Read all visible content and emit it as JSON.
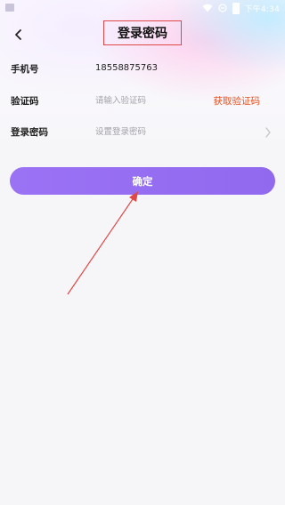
{
  "status_bar": {
    "time": "下午4:34"
  },
  "nav": {
    "back_icon": "chevron-left-icon",
    "title": "登录密码"
  },
  "form": {
    "phone": {
      "label": "手机号",
      "value": "18558875763"
    },
    "code": {
      "label": "验证码",
      "placeholder": "请输入验证码",
      "action": "获取验证码"
    },
    "password": {
      "label": "登录密码",
      "placeholder": "设置登录密码",
      "icon": "chevron-right-icon"
    }
  },
  "confirm": {
    "label": "确定"
  },
  "colors": {
    "accent": "#9b72f4",
    "get_code": "#e9501f",
    "annotation": "#e04848"
  }
}
